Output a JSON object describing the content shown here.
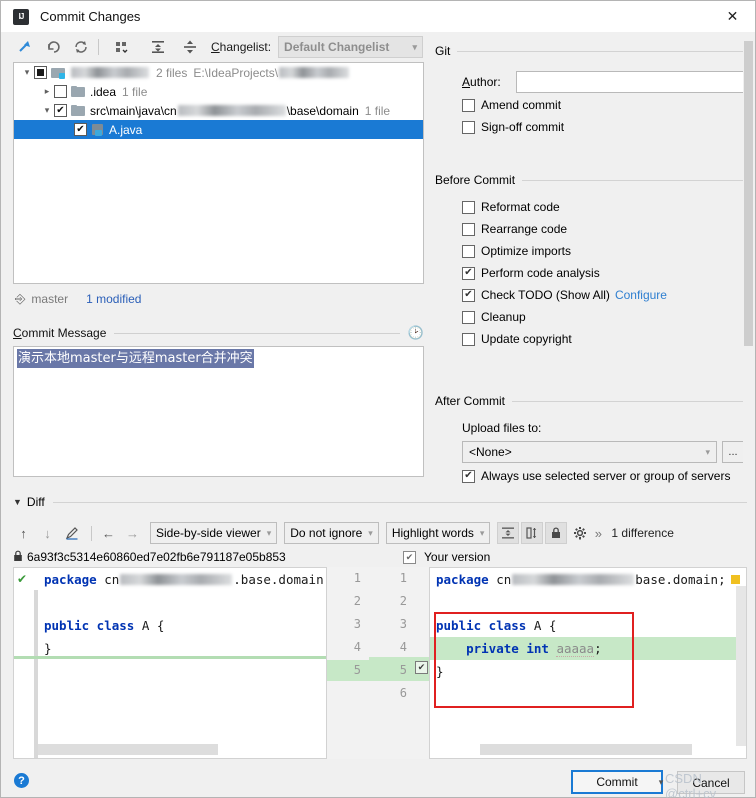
{
  "window": {
    "title": "Commit Changes",
    "app_icon": "intellij-idea-icon",
    "close_icon": "close-icon"
  },
  "toolbar": {
    "icons": [
      "refresh-changes-icon",
      "rollback-icon",
      "revert-icon",
      "group-by-icon",
      "expand-all-icon",
      "collapse-all-icon"
    ],
    "changelist_label": "Changelist:",
    "changelist_value": "Default Changelist"
  },
  "file_tree": {
    "rows": [
      {
        "indent": 0,
        "twisty": "down",
        "checkbox": "filled",
        "icon": "folder-module-icon",
        "name_blurred": true,
        "count": "2 files",
        "path_prefix": "E:\\IdeaProjects\\",
        "path_blurred": true
      },
      {
        "indent": 1,
        "twisty": "right",
        "checkbox": "unchecked",
        "icon": "folder-icon",
        "label": ".idea",
        "count": "1 file"
      },
      {
        "indent": 1,
        "twisty": "down",
        "checkbox": "checked",
        "icon": "folder-icon",
        "label": "src\\main\\java\\cn",
        "label_tail": "\\base\\domain",
        "count": "1 file"
      },
      {
        "indent": 2,
        "twisty": "none",
        "checkbox": "checked",
        "icon": "java-file-icon",
        "label": "A.java",
        "selected": true
      }
    ]
  },
  "branch_bar": {
    "icon": "git-branch-icon",
    "branch": "master",
    "status": "1 modified"
  },
  "commit_message": {
    "label": "Commit Message",
    "history_icon": "history-clock-icon",
    "value": "演示本地master与远程master合并冲突",
    "selected": true
  },
  "git_section": {
    "title": "Git",
    "author_label": "Author:",
    "author_value": "",
    "checkboxes": [
      {
        "label": "Amend commit",
        "checked": false
      },
      {
        "label": "Sign-off commit",
        "checked": false
      }
    ]
  },
  "before_commit": {
    "title": "Before Commit",
    "checkboxes": [
      {
        "label": "Reformat code",
        "checked": false
      },
      {
        "label": "Rearrange code",
        "checked": false
      },
      {
        "label": "Optimize imports",
        "checked": false
      },
      {
        "label": "Perform code analysis",
        "checked": true
      },
      {
        "label": "Check TODO (Show All)",
        "checked": true,
        "link": "Configure"
      },
      {
        "label": "Cleanup",
        "checked": false
      },
      {
        "label": "Update copyright",
        "checked": false
      }
    ]
  },
  "after_commit": {
    "title": "After Commit",
    "upload_label": "Upload files to:",
    "upload_value": "<None>",
    "browse_label": "...",
    "always_use_label": "Always use selected server or group of servers",
    "always_use_checked": true
  },
  "diff": {
    "title": "Diff",
    "toolbar": {
      "prev_icon": "arrow-up-icon",
      "next_icon": "arrow-down-icon",
      "edit_icon": "pencil-icon",
      "apply_left_icon": "arrow-left-icon",
      "apply_right_icon": "arrow-right-icon",
      "viewer_mode": "Side-by-side viewer",
      "ignore_mode": "Do not ignore",
      "highlight_mode": "Highlight words",
      "collapse_unchanged_icon": "collapse-unchanged-icon",
      "align_icon": "align-sides-icon",
      "lock_icon": "lock-icon",
      "settings_icon": "gear-icon",
      "more_icon": "chevron-more-icon",
      "difference_count": "1 difference"
    },
    "left_pane": {
      "lock_icon": "lock-icon",
      "revision": "6a93f3c5314e60860ed7e02fb6e791187e05b853",
      "lines": [
        {
          "num": 1,
          "tokens": [
            {
              "t": "package ",
              "c": "kw"
            },
            {
              "t": "cn",
              "c": "ident"
            },
            {
              "t": "BLUR",
              "c": "blur"
            },
            {
              "t": ".base.domain;",
              "c": "ident"
            }
          ]
        },
        {
          "num": 2,
          "tokens": []
        },
        {
          "num": 3,
          "tokens": [
            {
              "t": "public class ",
              "c": "kw"
            },
            {
              "t": "A {",
              "c": "ident"
            }
          ]
        },
        {
          "num": 4,
          "tokens": [
            {
              "t": "}",
              "c": "ident"
            }
          ]
        },
        {
          "num": 5,
          "tokens": []
        }
      ]
    },
    "right_pane": {
      "title": "Your version",
      "title_checked": true,
      "accept_change_icon": "accept-change-checkbox",
      "lines": [
        {
          "num_old": 1,
          "num_new": 1,
          "tokens": [
            {
              "t": "package ",
              "c": "kw"
            },
            {
              "t": "cn",
              "c": "ident"
            },
            {
              "t": "BLUR",
              "c": "blur"
            },
            {
              "t": "base.domain;",
              "c": "ident"
            }
          ]
        },
        {
          "num_old": 2,
          "num_new": 2,
          "tokens": []
        },
        {
          "num_old": 3,
          "num_new": 3,
          "tokens": [
            {
              "t": "public class ",
              "c": "kw"
            },
            {
              "t": "A {",
              "c": "ident"
            }
          ]
        },
        {
          "num_old": 4,
          "num_new": 4,
          "added": true,
          "tokens": [
            {
              "t": "    private int ",
              "c": "kw"
            },
            {
              "t": "aaaaa;",
              "c": "fld"
            }
          ]
        },
        {
          "num_old": 5,
          "num_new": 5,
          "tokens": [
            {
              "t": "}",
              "c": "ident"
            }
          ]
        },
        {
          "num_old": "",
          "num_new": 6,
          "tokens": []
        }
      ]
    }
  },
  "footer": {
    "help_icon": "help-icon",
    "commit_label": "Commit",
    "commit_dropdown_icon": "chevron-down-icon",
    "cancel_label": "Cancel"
  },
  "watermark": "CSDN @ctrl+cv",
  "colors": {
    "selection_blue": "#1a7ad4",
    "link_blue": "#2f7fd0",
    "diff_added_green": "#c7e8c7",
    "highlight_red": "#e02020",
    "text_selection": "#6a78a8"
  }
}
